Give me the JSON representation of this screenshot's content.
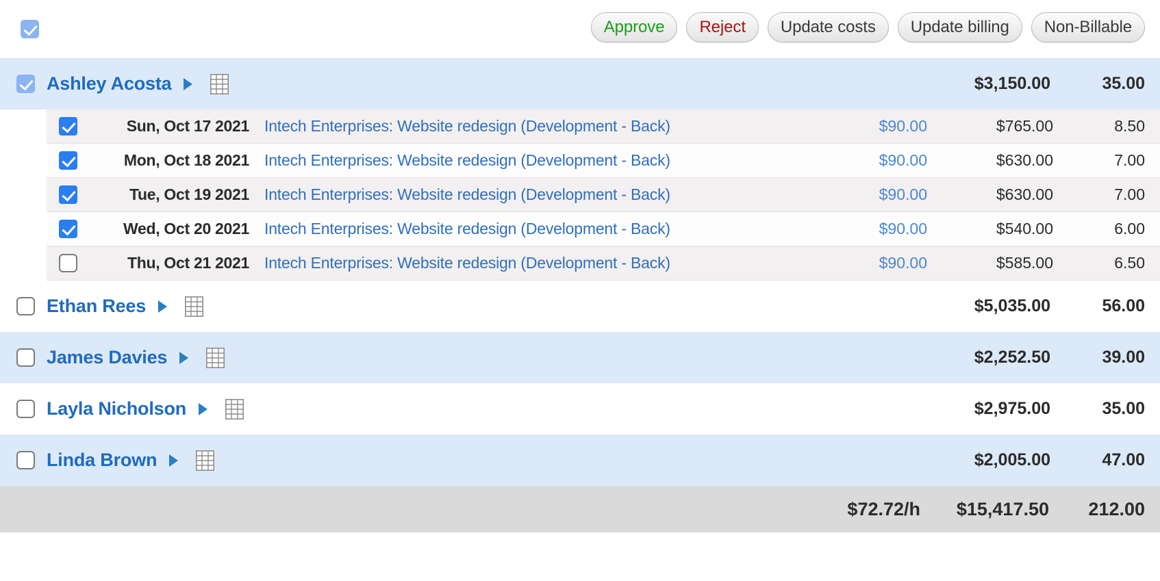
{
  "toolbar": {
    "select_all_checked": true,
    "buttons": [
      {
        "label": "Approve",
        "style": "approve"
      },
      {
        "label": "Reject",
        "style": "reject"
      },
      {
        "label": "Update costs",
        "style": "default"
      },
      {
        "label": "Update billing",
        "style": "default"
      },
      {
        "label": "Non-Billable",
        "style": "default"
      }
    ]
  },
  "colors": {
    "group_row_tint": "#dce9f8",
    "detail_row_shade": "#f3f0f1",
    "link_blue": "#2f6fbf",
    "name_blue": "#1f6bc0",
    "approve_green": "#18a018",
    "reject_red": "#a81414",
    "total_gray": "#dadada",
    "checkbox_bold_blue": "#2a7ef0",
    "checkbox_soft_blue": "#8ab4f2"
  },
  "groups": [
    {
      "name": "Ashley Acosta",
      "checkbox": "checked-soft",
      "expanded": true,
      "amount": "$3,150.00",
      "hours": "35.00",
      "row_style": "tint",
      "expand_icon": "triangle-right-icon",
      "grid_icon": "grid-icon",
      "entries": [
        {
          "checkbox": "checked-bold",
          "date": "Sun, Oct 17 2021",
          "task": "Intech Enterprises: Website redesign (Development - Back)",
          "rate": "$90.00",
          "amount": "$765.00",
          "hours": "8.50",
          "shade": "shade"
        },
        {
          "checkbox": "checked-bold",
          "date": "Mon, Oct 18 2021",
          "task": "Intech Enterprises: Website redesign (Development - Back)",
          "rate": "$90.00",
          "amount": "$630.00",
          "hours": "7.00",
          "shade": "white"
        },
        {
          "checkbox": "checked-bold",
          "date": "Tue, Oct 19 2021",
          "task": "Intech Enterprises: Website redesign (Development - Back)",
          "rate": "$90.00",
          "amount": "$630.00",
          "hours": "7.00",
          "shade": "shade"
        },
        {
          "checkbox": "checked-bold",
          "date": "Wed, Oct 20 2021",
          "task": "Intech Enterprises: Website redesign (Development - Back)",
          "rate": "$90.00",
          "amount": "$540.00",
          "hours": "6.00",
          "shade": "white"
        },
        {
          "checkbox": "unchecked",
          "date": "Thu, Oct 21 2021",
          "task": "Intech Enterprises: Website redesign (Development - Back)",
          "rate": "$90.00",
          "amount": "$585.00",
          "hours": "6.50",
          "shade": "shade"
        }
      ]
    },
    {
      "name": "Ethan Rees",
      "checkbox": "unchecked",
      "expanded": false,
      "amount": "$5,035.00",
      "hours": "56.00",
      "row_style": "plain",
      "expand_icon": "triangle-right-icon",
      "grid_icon": "grid-icon",
      "entries": []
    },
    {
      "name": "James Davies",
      "checkbox": "unchecked",
      "expanded": false,
      "amount": "$2,252.50",
      "hours": "39.00",
      "row_style": "tint",
      "expand_icon": "triangle-right-icon",
      "grid_icon": "grid-icon",
      "entries": []
    },
    {
      "name": "Layla Nicholson",
      "checkbox": "unchecked",
      "expanded": false,
      "amount": "$2,975.00",
      "hours": "35.00",
      "row_style": "plain",
      "expand_icon": "triangle-right-icon",
      "grid_icon": "grid-icon",
      "entries": []
    },
    {
      "name": "Linda Brown",
      "checkbox": "unchecked",
      "expanded": false,
      "amount": "$2,005.00",
      "hours": "47.00",
      "row_style": "tint",
      "expand_icon": "triangle-right-icon",
      "grid_icon": "grid-icon",
      "entries": []
    }
  ],
  "grand_total": {
    "rate": "$72.72/h",
    "amount": "$15,417.50",
    "hours": "212.00"
  }
}
